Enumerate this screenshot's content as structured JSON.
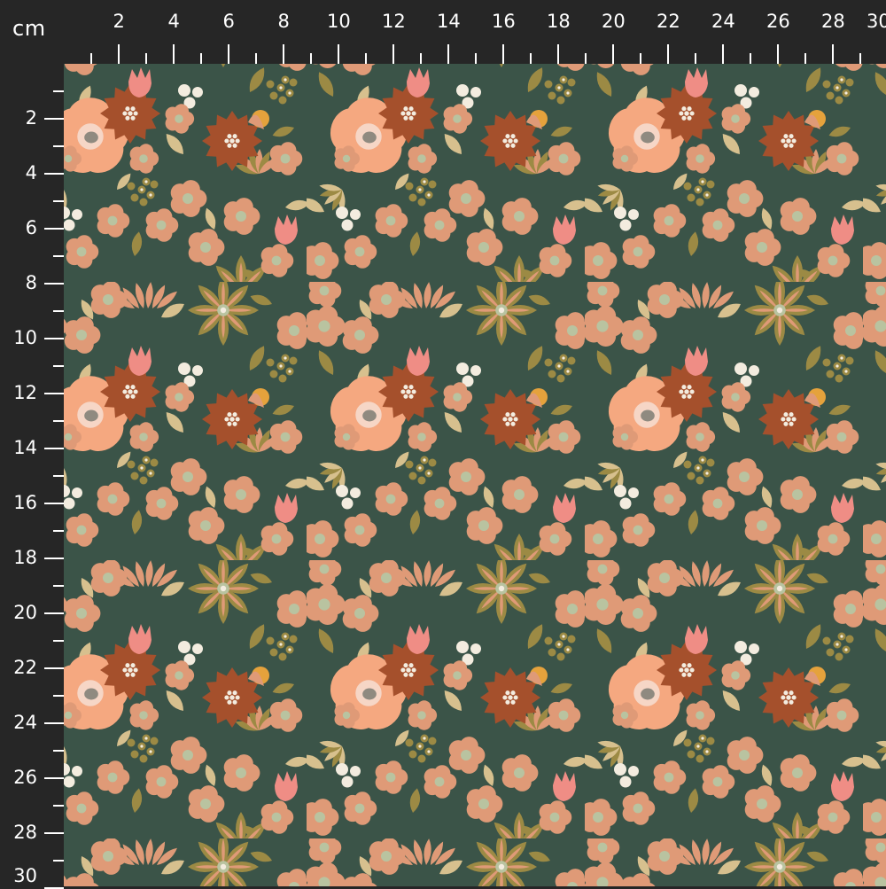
{
  "unit_label": "cm",
  "ruler": {
    "labels": [
      2,
      4,
      6,
      8,
      10,
      12,
      14,
      16,
      18,
      20,
      22,
      24,
      26,
      28,
      30
    ],
    "max_cm": 30,
    "minor_step_cm": 1
  },
  "fabric": {
    "description_icon": "floral-pattern",
    "palette": {
      "background": "#3b5448",
      "peach": "#f5a880",
      "salmon": "#df9a77",
      "rust": "#a5502c",
      "olive": "#9c8a44",
      "khaki": "#d7c08e",
      "pink": "#ef8d85",
      "cream": "#f3ecdf",
      "sage": "#b9c3a0"
    }
  }
}
